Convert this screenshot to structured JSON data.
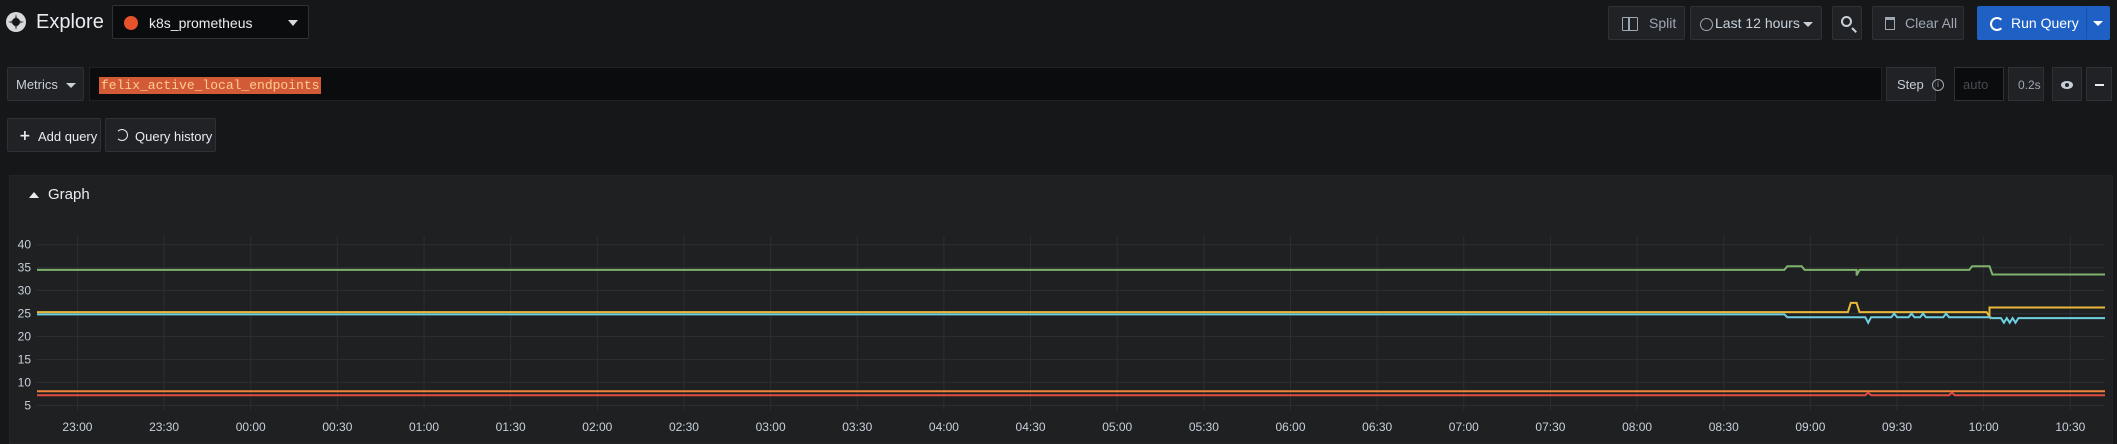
{
  "header": {
    "title": "Explore",
    "datasource": "k8s_prometheus",
    "datasource_color": "#e6522c",
    "split_label": "Split",
    "time_range": "Last 12 hours",
    "clear_label": "Clear All",
    "run_label": "Run Query",
    "run_color": "#1f60c4"
  },
  "query": {
    "metrics_label": "Metrics",
    "expression": "felix_active_local_endpoints",
    "step_label": "Step",
    "step_placeholder": "auto",
    "duration": "0.2s"
  },
  "actions": {
    "add_query": "Add query",
    "query_history": "Query history"
  },
  "graph": {
    "title": "Graph"
  },
  "chart_data": {
    "type": "line",
    "title": "",
    "xlabel": "",
    "ylabel": "",
    "ylim": [
      4,
      41
    ],
    "yticks": [
      "5",
      "10",
      "15",
      "20",
      "25",
      "30",
      "35",
      "40"
    ],
    "xticks": [
      "23:00",
      "23:30",
      "00:00",
      "00:30",
      "01:00",
      "01:30",
      "02:00",
      "02:30",
      "03:00",
      "03:30",
      "04:00",
      "04:30",
      "05:00",
      "05:30",
      "06:00",
      "06:30",
      "07:00",
      "07:30",
      "08:00",
      "08:30",
      "09:00",
      "09:30",
      "10:00",
      "10:30"
    ],
    "grid": true,
    "x_range": [
      "22:46",
      "10:42"
    ],
    "series": [
      {
        "color": "#7eb26d",
        "points": [
          [
            "22:46",
            34.5
          ],
          [
            "08:51",
            34.5
          ],
          [
            "08:52",
            35.3
          ],
          [
            "08:57",
            35.3
          ],
          [
            "08:58",
            34.5
          ],
          [
            "09:16",
            34.5
          ],
          [
            "09:16",
            33.3
          ],
          [
            "09:17",
            34.5
          ],
          [
            "09:55",
            34.5
          ],
          [
            "09:56",
            35.3
          ],
          [
            "10:02",
            35.3
          ],
          [
            "10:03",
            33.5
          ],
          [
            "10:42",
            33.5
          ]
        ]
      },
      {
        "color": "#eab839",
        "points": [
          [
            "22:46",
            25.3
          ],
          [
            "09:13",
            25.3
          ],
          [
            "09:14",
            27.3
          ],
          [
            "09:16",
            27.3
          ],
          [
            "09:17",
            25.3
          ],
          [
            "09:55",
            25.3
          ],
          [
            "10:01",
            25.3
          ],
          [
            "10:02",
            24.3
          ],
          [
            "10:02",
            26.3
          ],
          [
            "10:42",
            26.3
          ]
        ]
      },
      {
        "color": "#6ed0e0",
        "points": [
          [
            "22:46",
            24.8
          ],
          [
            "08:51",
            24.8
          ],
          [
            "08:52",
            24.2
          ],
          [
            "09:19",
            24.2
          ],
          [
            "09:20",
            23.0
          ],
          [
            "09:21",
            24.2
          ],
          [
            "09:28",
            24.2
          ],
          [
            "09:29",
            25.0
          ],
          [
            "09:30",
            24.2
          ],
          [
            "09:34",
            24.2
          ],
          [
            "09:35",
            25.0
          ],
          [
            "09:36",
            24.2
          ],
          [
            "09:38",
            24.2
          ],
          [
            "09:39",
            25.0
          ],
          [
            "09:40",
            24.2
          ],
          [
            "09:46",
            24.2
          ],
          [
            "09:47",
            25.0
          ],
          [
            "09:48",
            24.2
          ],
          [
            "09:55",
            24.2
          ],
          [
            "10:02",
            24.2
          ],
          [
            "10:03",
            24.0
          ],
          [
            "10:06",
            24.0
          ],
          [
            "10:07",
            23.0
          ],
          [
            "10:08",
            24.0
          ],
          [
            "10:09",
            23.0
          ],
          [
            "10:10",
            24.0
          ],
          [
            "10:11",
            23.0
          ],
          [
            "10:12",
            24.0
          ],
          [
            "10:42",
            24.0
          ]
        ]
      },
      {
        "color": "#ef843c",
        "points": [
          [
            "22:46",
            8.1
          ],
          [
            "10:42",
            8.1
          ]
        ]
      },
      {
        "color": "#e24d42",
        "points": [
          [
            "22:46",
            7.2
          ],
          [
            "09:19",
            7.2
          ],
          [
            "09:20",
            7.8
          ],
          [
            "09:21",
            7.2
          ],
          [
            "09:48",
            7.2
          ],
          [
            "09:49",
            7.8
          ],
          [
            "09:50",
            7.2
          ],
          [
            "10:42",
            7.2
          ]
        ]
      }
    ]
  }
}
